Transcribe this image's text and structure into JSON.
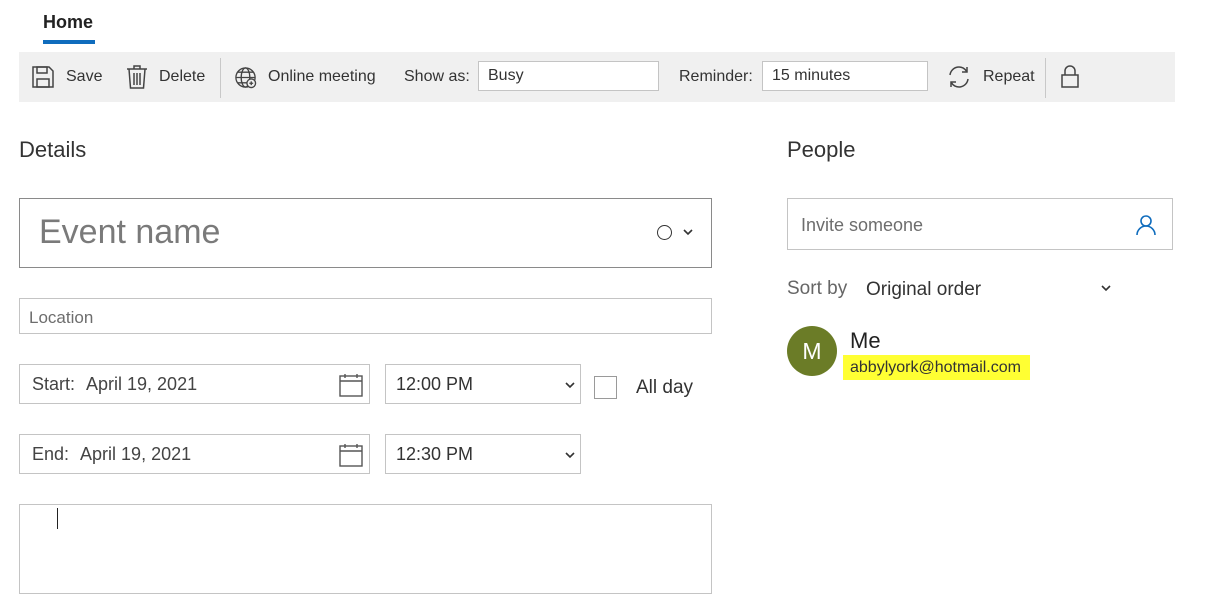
{
  "tabs": [
    {
      "label": "Home",
      "active": true
    }
  ],
  "toolbar": {
    "save_label": "Save",
    "delete_label": "Delete",
    "online_meeting_label": "Online meeting",
    "show_as_label": "Show as:",
    "show_as_value": "Busy",
    "reminder_label": "Reminder:",
    "reminder_value": "15 minutes",
    "repeat_label": "Repeat",
    "icons": [
      "save-icon",
      "trash-icon",
      "globe-icon",
      "repeat-icon",
      "lock-icon"
    ]
  },
  "details": {
    "title": "Details",
    "event_name_placeholder": "Event name",
    "location_placeholder": "Location",
    "start": {
      "label": "Start:",
      "date": "April 19, 2021",
      "time": "12:00 PM"
    },
    "end": {
      "label": "End:",
      "date": "April 19, 2021",
      "time": "12:30 PM"
    },
    "all_day": {
      "label": "All day",
      "checked": false
    },
    "notes": ""
  },
  "people": {
    "title": "People",
    "invite_placeholder": "Invite someone",
    "sort_by_label": "Sort by",
    "sort_by_value": "Original order",
    "attendees": [
      {
        "initial": "M",
        "name": "Me",
        "email": "abbylyork@hotmail.com",
        "avatar_color": "#6b7c27",
        "highlight_color": "#ffff33"
      }
    ]
  },
  "colors": {
    "accent": "#0f6cbd",
    "toolbar_bg": "#f0f0f0",
    "avatar": "#6b7c27",
    "highlight": "#ffff33"
  }
}
